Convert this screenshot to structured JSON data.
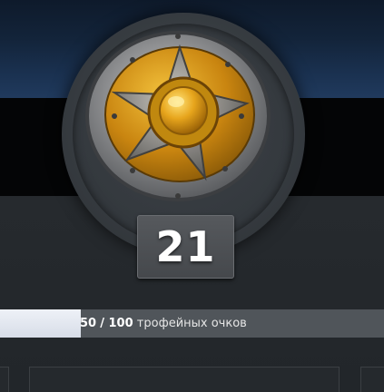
{
  "level": "21",
  "progress": {
    "current": "50",
    "separator": "/",
    "max": "100",
    "unit_text": "трофейных очков",
    "fraction": 0.5
  },
  "icons": {
    "medal": "shield-medal-icon"
  },
  "colors": {
    "progress_fill": "#e4e8f0",
    "progress_track": "#50555a",
    "shield_gold": "#e3a21a"
  }
}
